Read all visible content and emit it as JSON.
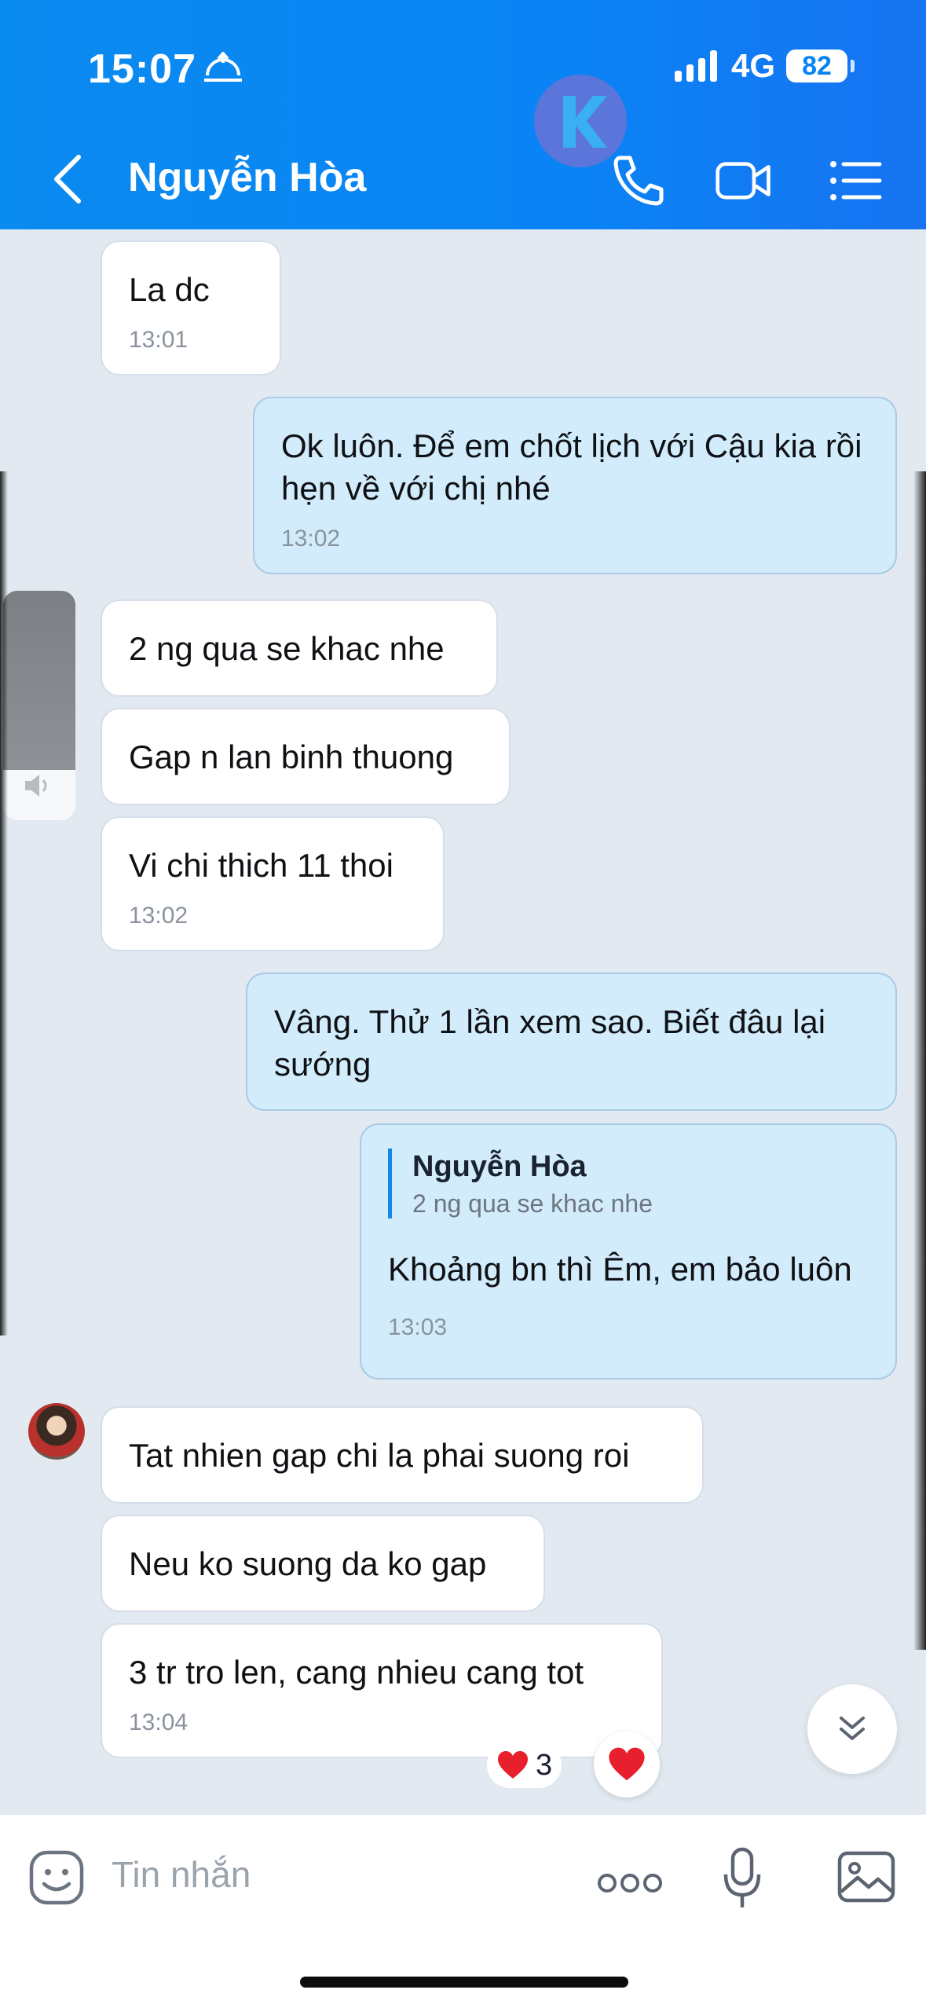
{
  "status_bar": {
    "time": "15:07",
    "network": "4G",
    "battery": "82"
  },
  "header": {
    "title": "Nguyễn Hòa"
  },
  "messages": [
    {
      "text": "La dc",
      "time": "13:01"
    },
    {
      "text": "Ok luôn. Để em chốt lịch với Cậu kia rồi hẹn về với chị nhé",
      "time": "13:02"
    },
    {
      "text": "2 ng qua se khac nhe"
    },
    {
      "text": "Gap n lan binh thuong"
    },
    {
      "text": "Vi chi thich 11 thoi",
      "time": "13:02"
    },
    {
      "text": "Vâng. Thử 1 lần xem sao. Biết đâu lại sướng"
    },
    {
      "reply_to": {
        "name": "Nguyễn Hòa",
        "text": "2 ng qua se khac nhe"
      },
      "text": "Khoảng bn thì Êm, em bảo luôn",
      "time": "13:03"
    },
    {
      "text": "Tat nhien gap chi la phai suong roi"
    },
    {
      "text": "Neu ko suong da ko gap"
    },
    {
      "text": "3 tr tro len, cang nhieu cang tot",
      "time": "13:04",
      "reaction_count": "3"
    }
  ],
  "composer": {
    "placeholder": "Tin nhắn"
  },
  "colors": {
    "header": "#0a84f5",
    "outgoing_bubble": "#d2ecfb",
    "incoming_bubble": "#ffffff",
    "background": "#e2e9f1",
    "reaction": "#e8202e"
  }
}
